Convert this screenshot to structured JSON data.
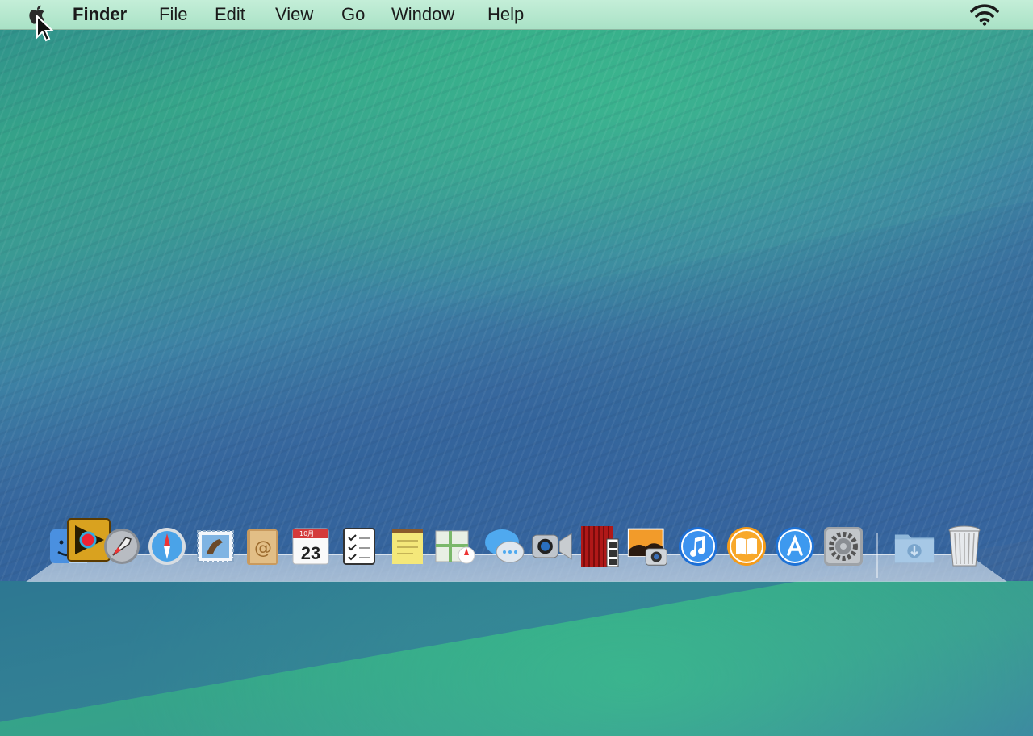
{
  "menubar": {
    "app_name": "Finder",
    "items": [
      "File",
      "Edit",
      "View",
      "Go",
      "Window",
      "Help"
    ]
  },
  "dock": {
    "calendar_day": "23",
    "calendar_month": "10月",
    "apps": [
      "Finder",
      "Cinematic app",
      "Launchpad",
      "Safari",
      "Mail",
      "Contacts",
      "Calendar",
      "Reminders",
      "Notes",
      "Maps",
      "Messages",
      "FaceTime",
      "Photo Booth",
      "iPhoto",
      "iTunes",
      "iBooks",
      "App Store",
      "System Preferences",
      "Downloads",
      "Trash"
    ]
  },
  "colors": {
    "menubar_bg": "#b8e8cf",
    "wallpaper_top": "#35a389",
    "wallpaper_bottom": "#3a659b"
  }
}
